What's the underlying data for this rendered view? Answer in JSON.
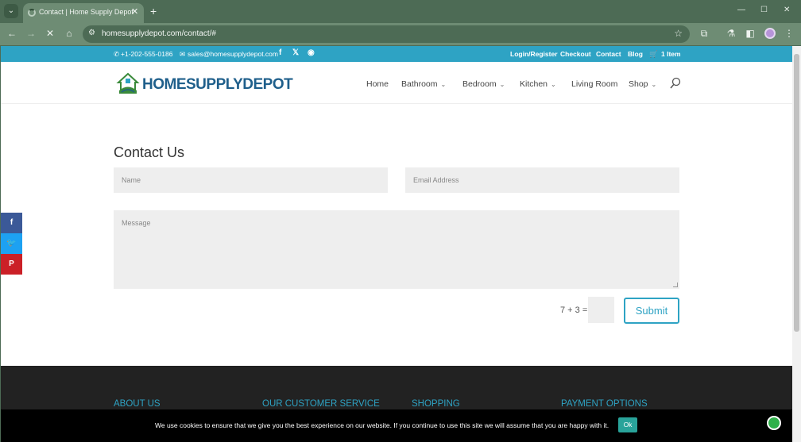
{
  "browser": {
    "tab_title": "Contact | Home Supply Depot",
    "url": "homesupplydepot.com/contact/#"
  },
  "topbar": {
    "phone": "+1-202-555-0186",
    "email": "sales@homesupplydepot.com",
    "links": [
      "Login/Register",
      "Checkout",
      "Contact",
      "Blog"
    ],
    "cart": "1 Item"
  },
  "logo": {
    "part1": "HOME",
    "part2": "SUPPLY",
    "part3": "DEPOT"
  },
  "nav": {
    "home": "Home",
    "bathroom": "Bathroom",
    "bedroom": "Bedroom",
    "kitchen": "Kitchen",
    "living_room": "Living Room",
    "shop": "Shop"
  },
  "form": {
    "title": "Contact Us",
    "name_placeholder": "Name",
    "email_placeholder": "Email Address",
    "message_placeholder": "Message",
    "captcha": "7 + 3 =",
    "submit": "Submit"
  },
  "footer": {
    "about": "ABOUT US",
    "service": "OUR CUSTOMER SERVICE",
    "shopping": "SHOPPING",
    "payment": "PAYMENT OPTIONS"
  },
  "cookie": {
    "text": "We use cookies to ensure that we give you the best experience on our website. If you continue to use this site we will assume that you are happy with it.",
    "ok": "Ok"
  },
  "colors": {
    "accent": "#2ea3c4",
    "facebook": "#3b5998",
    "twitter": "#1da1f2",
    "pinterest": "#cb2027"
  }
}
